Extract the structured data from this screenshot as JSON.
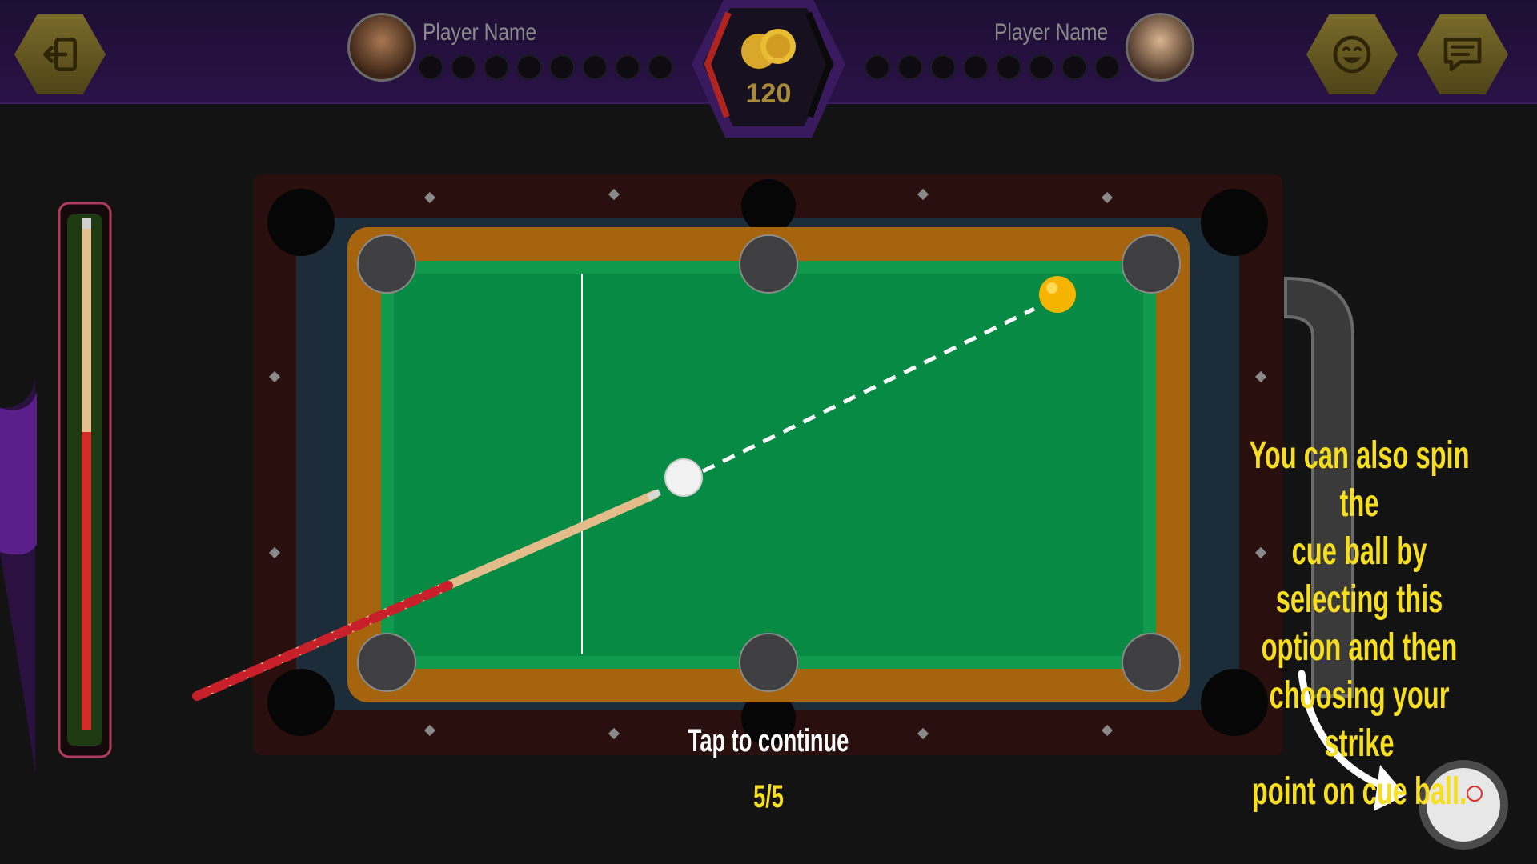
{
  "header": {
    "player_left_name": "Player Name",
    "player_right_name": "Player Name",
    "coins": "120"
  },
  "buttons": {
    "exit_icon": "exit-icon",
    "emoji_icon": "emoji-icon",
    "chat_icon": "chat-icon"
  },
  "tutorial": {
    "message_lines": [
      "You can also spin the",
      "cue ball by selecting this",
      "option and then",
      "choosing your strike",
      "point on cue ball."
    ],
    "tap_to_continue": "Tap to continue",
    "step": "5/5"
  },
  "colors": {
    "felt": "#078a43",
    "rail": "#a5640d",
    "highlight_text": "#f7de1e",
    "hex_button": "#6b5d22",
    "topbar": "#25103f"
  }
}
